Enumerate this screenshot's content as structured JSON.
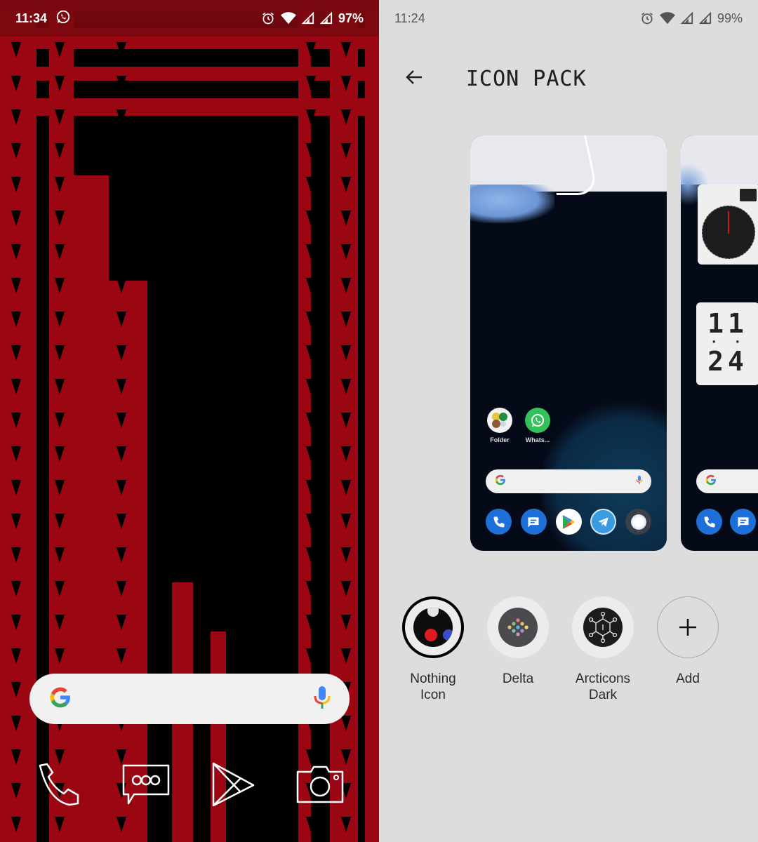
{
  "left_screen": {
    "status_bar": {
      "time": "11:34",
      "battery": "97%",
      "notification_icons": [
        "whatsapp-icon"
      ],
      "system_icons": [
        "alarm-icon",
        "wifi-icon",
        "signal-icon",
        "signal-icon"
      ]
    },
    "search_bar": {
      "left_icon": "google-g-icon",
      "right_icon": "microphone-icon"
    },
    "dock": [
      {
        "name": "Phone",
        "icon": "phone-icon"
      },
      {
        "name": "Messages",
        "icon": "message-icon"
      },
      {
        "name": "Play Store",
        "icon": "play-store-icon"
      },
      {
        "name": "Camera",
        "icon": "camera-icon"
      }
    ],
    "wallpaper_colors": {
      "red": "#9a0712",
      "black": "#000000"
    }
  },
  "right_screen": {
    "status_bar": {
      "time": "11:24",
      "battery": "99%",
      "system_icons": [
        "alarm-icon",
        "wifi-icon",
        "signal-icon",
        "signal-icon"
      ]
    },
    "header": {
      "title": "ICON PACK",
      "back_icon": "arrow-left-icon"
    },
    "preview": {
      "apps": [
        {
          "label": "Folder",
          "icon": "folder-icon"
        },
        {
          "label": "Whats...",
          "icon": "whatsapp-icon"
        }
      ],
      "dock": [
        "phone-icon",
        "messages-icon",
        "play-store-icon",
        "telegram-icon",
        "circle-icon"
      ]
    },
    "preview_secondary": {
      "digital_clock": {
        "hours": "11",
        "minutes": "24"
      },
      "dock": [
        "phone-icon",
        "messages-icon"
      ]
    },
    "icon_packs": [
      {
        "name": "Nothing\nIcon",
        "selected": true,
        "icon": "nothing-icon"
      },
      {
        "name": "Delta",
        "selected": false,
        "icon": "delta-icon"
      },
      {
        "name": "Arcticons\nDark",
        "selected": false,
        "icon": "arcticons-icon"
      },
      {
        "name": "Add",
        "selected": false,
        "icon": "plus-icon"
      }
    ],
    "colors": {
      "background": "#dcdddc",
      "text": "#2b2b2b",
      "selected_ring": "#000000"
    }
  }
}
